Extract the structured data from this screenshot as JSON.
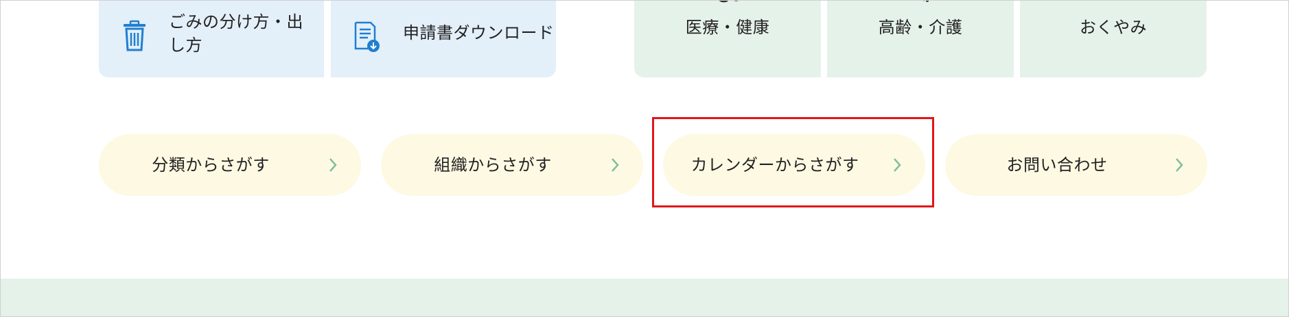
{
  "quick_links": [
    {
      "label": "ごみの分け方・出し方",
      "icon": "trash-icon"
    },
    {
      "label": "申請書ダウンロード",
      "icon": "document-download-icon"
    }
  ],
  "categories": [
    {
      "label": "医療・健康"
    },
    {
      "label": "高齢・介護"
    },
    {
      "label": "おくやみ"
    }
  ],
  "search_buttons": [
    {
      "label": "分類からさがす"
    },
    {
      "label": "組織からさがす"
    },
    {
      "label": "カレンダーからさがす"
    },
    {
      "label": "お問い合わせ"
    }
  ],
  "colors": {
    "quick_link_bg": "#e3eff9",
    "category_bg": "#e5f2ea",
    "pill_bg": "#fef9e3",
    "chevron": "#7fbf9b",
    "icon_blue": "#1f7fd1",
    "highlight": "#e3141a"
  }
}
